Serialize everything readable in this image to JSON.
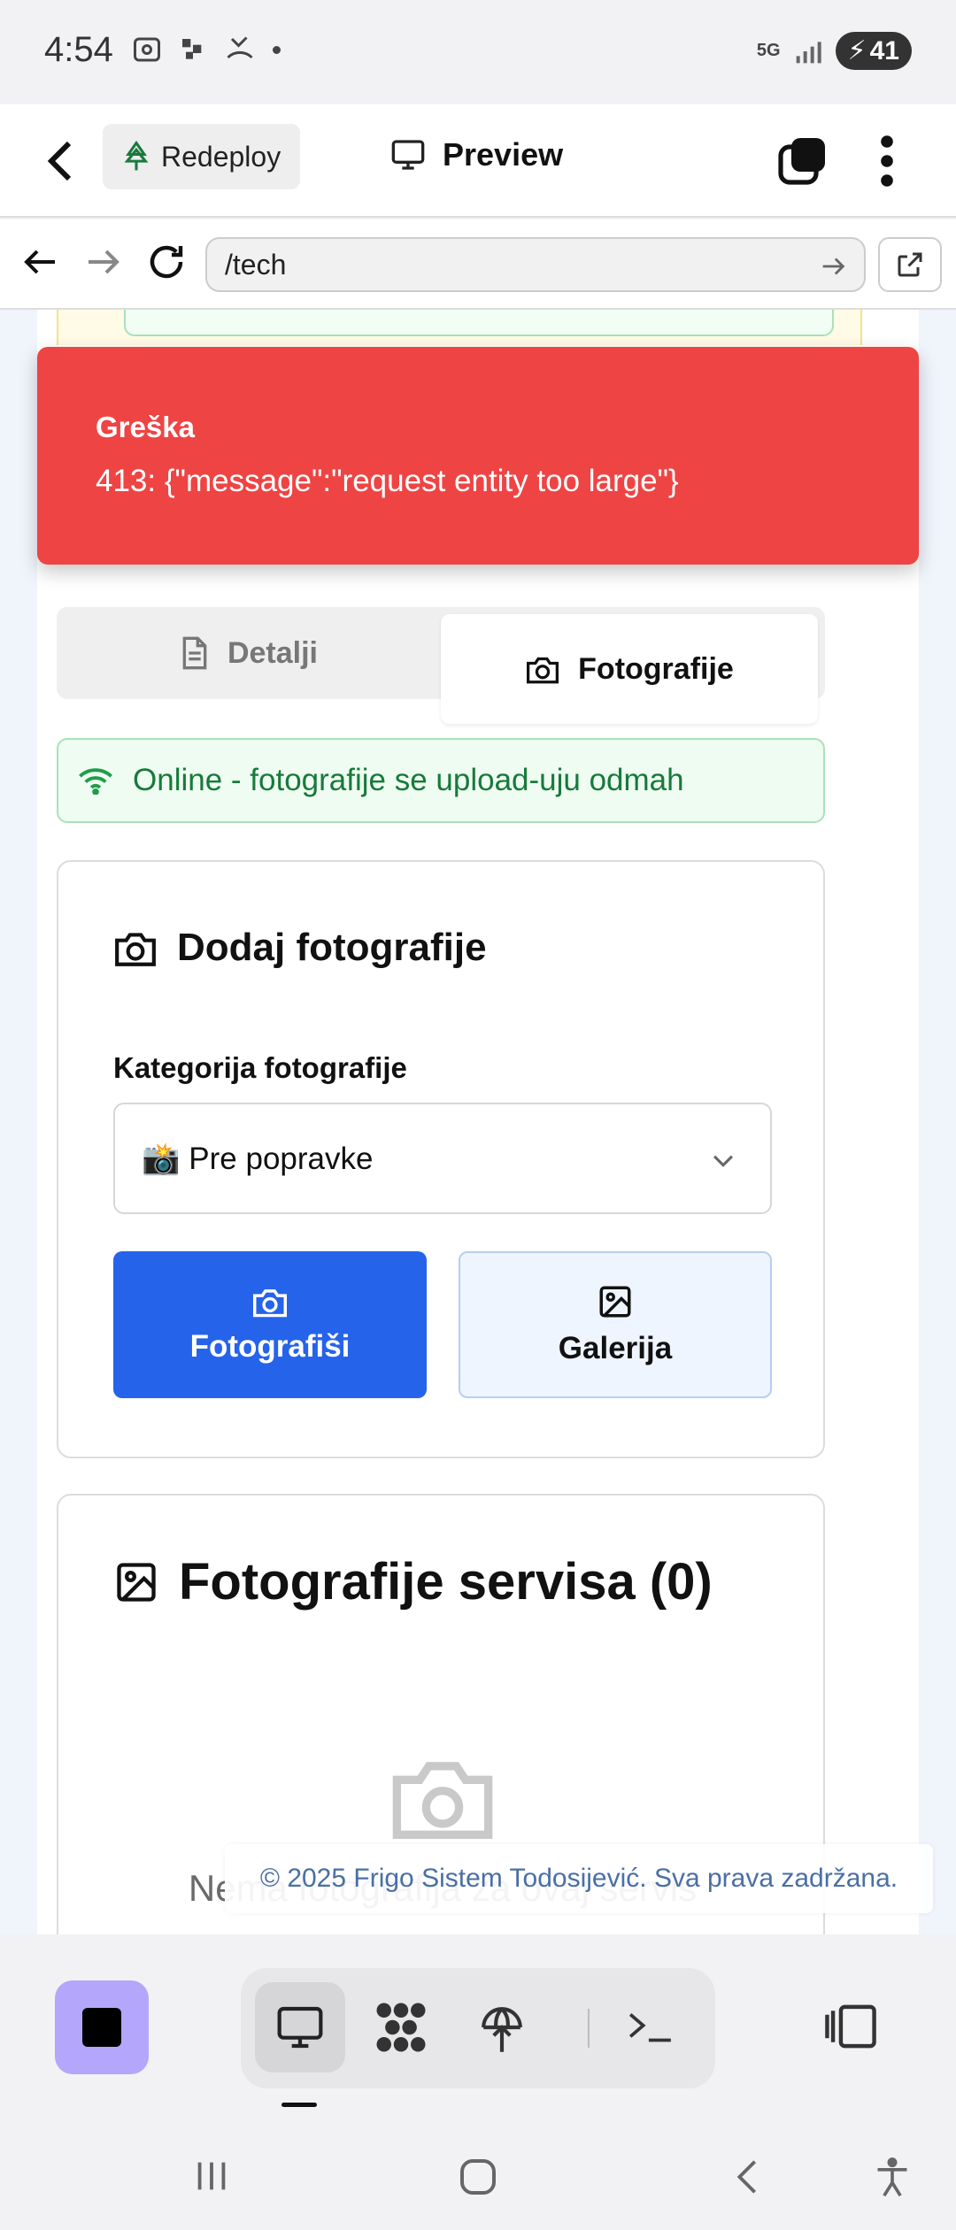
{
  "status_bar": {
    "time": "4:54",
    "network": "5G",
    "battery": "41"
  },
  "app_header": {
    "redeploy_label": "Redeploy",
    "preview_label": "Preview"
  },
  "browser": {
    "url": "/tech"
  },
  "toast": {
    "title": "Greška",
    "message": "413: {\"message\":\"request entity too large\"}"
  },
  "tabs": {
    "details_label": "Detalji",
    "photos_label": "Fotografije",
    "active": "photos"
  },
  "online_banner": {
    "text": "Online - fotografije se upload-uju odmah"
  },
  "upload_card": {
    "title": "Dodaj fotografije",
    "category_label": "Kategorija fotografije",
    "category_selected": "📸 Pre popravke",
    "camera_button": "Fotografiši",
    "gallery_button": "Galerija"
  },
  "gallery_card": {
    "title": "Fotografije servisa (0)",
    "empty_text": "Nema fotografija za ovaj servis"
  },
  "footer": {
    "copyright": "© 2025 Frigo Sistem Todosijević. Sva prava zadržana."
  },
  "colors": {
    "error_bg": "#ef4444",
    "primary_button": "#2563eb",
    "online_text": "#177a3a",
    "stop_button": "#b4a6fb"
  }
}
